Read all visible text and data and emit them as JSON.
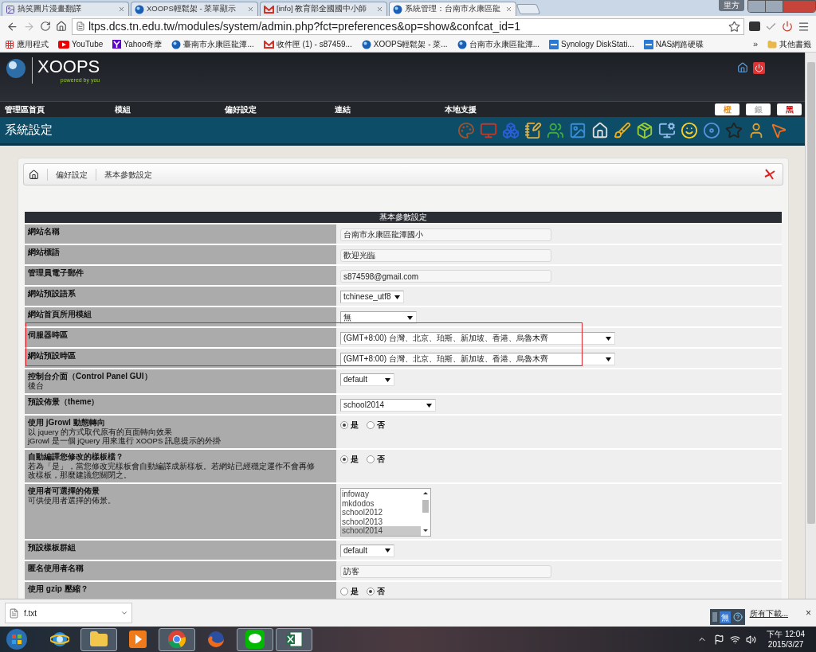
{
  "browser_tabs": [
    {
      "title": "搞笑圖片漫畫翻譯",
      "kind": "image",
      "selected": false
    },
    {
      "title": "XOOPS輕鬆架 - 菜單顯示",
      "kind": "globe",
      "selected": false
    },
    {
      "title": "[info] 教育部全國國中小師",
      "kind": "gmail",
      "selected": false
    },
    {
      "title": "系統管理：台南市永康區龍",
      "kind": "globe",
      "selected": true
    }
  ],
  "profile": "里方",
  "address": {
    "url": "ltps.dcs.tn.edu.tw/modules/system/admin.php?fct=preferences&op=show&confcat_id=1"
  },
  "bookmarks": [
    {
      "label": "應用程式",
      "kind": "apps"
    },
    {
      "label": "YouTube",
      "kind": "youtube"
    },
    {
      "label": "Yahoo奇摩",
      "kind": "yahoo"
    },
    {
      "label": "臺南市永康區龍潭...",
      "kind": "globe"
    },
    {
      "label": "收件匣 (1) - s87459...",
      "kind": "gmail"
    },
    {
      "label": "XOOPS輕鬆架 - 菜...",
      "kind": "globe"
    },
    {
      "label": "台南市永康區龍潭...",
      "kind": "globe"
    },
    {
      "label": "Synology DiskStati...",
      "kind": "dsm"
    },
    {
      "label": "NAS網路硬碟",
      "kind": "dsm"
    }
  ],
  "bookmarks_more": "»",
  "other_bookmarks": "其他書籤",
  "header": {
    "logo": "XOOPS",
    "tagline": "powered by you"
  },
  "nav": {
    "items": [
      "管理區首頁",
      "模組",
      "偏好設定",
      "連結",
      "本地支援"
    ],
    "themes": [
      {
        "label": "橙",
        "color": "#f08c00"
      },
      {
        "label": "銀",
        "color": "#b0b0b0"
      },
      {
        "label": "黑",
        "color": "#d40000"
      }
    ]
  },
  "page_title": "系統設定",
  "breadcrumb": [
    "偏好設定",
    "基本參數設定"
  ],
  "settings": {
    "title": "基本參數設定",
    "rows": [
      {
        "label": "網站名稱",
        "kind": "text",
        "value": "台南市永康區龍潭國小",
        "highlighted": false
      },
      {
        "label": "網站標語",
        "kind": "text",
        "value": "歡迎光臨",
        "highlighted": false
      },
      {
        "label": "管理員電子郵件",
        "kind": "text",
        "value": "s874598@gmail.com",
        "highlighted": false
      },
      {
        "label": "網站預設語系",
        "kind": "select",
        "value": "tchinese_utf8",
        "highlighted": false
      },
      {
        "label": "網站首頁所用模組",
        "kind": "select",
        "value": "無",
        "highlighted": false
      },
      {
        "label": "伺服器時區",
        "kind": "select",
        "value": "(GMT+8:00) 台灣、北京、珀斯、新加坡、香港、烏魯木齊",
        "highlighted": true
      },
      {
        "label": "網站預設時區",
        "kind": "select",
        "value": "(GMT+8:00) 台灣、北京、珀斯、新加坡、香港、烏魯木齊",
        "highlighted": true
      },
      {
        "label": "控制台介面（Control Panel GUI）",
        "description": [
          "後台"
        ],
        "kind": "select",
        "value": "default",
        "highlighted": false
      },
      {
        "label": "預設佈景（theme）",
        "kind": "select",
        "value": "school2014",
        "highlighted": false
      },
      {
        "label": "使用 jGrowl 動態轉向",
        "description": [
          "以 jquery 的方式取代原有的頁面轉向效果",
          "jGrowl 是一個 jQuery 用來進行 XOOPS 訊息提示的外掛"
        ],
        "kind": "radio",
        "options": [
          {
            "label": "是",
            "selected": true
          },
          {
            "label": "否",
            "selected": false
          }
        ],
        "highlighted": false
      },
      {
        "label": "自動編譯您修改的樣板檔？",
        "description": [
          "若為「是」，當您修改完樣板會自動編譯成新樣板。若網站已經穩定運作不會再修改樣板，那麼建議您關閉之。"
        ],
        "kind": "radio",
        "options": [
          {
            "label": "是",
            "selected": true
          },
          {
            "label": "否",
            "selected": false
          }
        ],
        "highlighted": false
      },
      {
        "label": "使用者可選擇的佈景",
        "description": [
          "可供使用者選擇的佈景。"
        ],
        "kind": "listbox",
        "options": [
          {
            "label": "infoway",
            "selected": false
          },
          {
            "label": "mkdodos",
            "selected": false
          },
          {
            "label": "school2012",
            "selected": false
          },
          {
            "label": "school2013",
            "selected": false
          },
          {
            "label": "school2014",
            "selected": true
          }
        ],
        "highlighted": false
      },
      {
        "label": "預設樣板群組",
        "kind": "select",
        "value": "default",
        "highlighted": false
      },
      {
        "label": "匿名使用者名稱",
        "kind": "text",
        "value": "訪客",
        "highlighted": false
      },
      {
        "label": "使用 gzip 壓縮？",
        "kind": "radio",
        "options": [
          {
            "label": "是",
            "selected": false
          },
          {
            "label": "否",
            "selected": true
          }
        ],
        "highlighted": false
      }
    ]
  },
  "downloads": {
    "file": "f.txt",
    "show_all": "所有下載...",
    "close": "×",
    "ime": "無"
  },
  "taskbar": {
    "apps": [
      {
        "kind": "ie",
        "running": false
      },
      {
        "kind": "folder",
        "running": true
      },
      {
        "kind": "media",
        "running": false
      },
      {
        "kind": "chrome",
        "running": true
      },
      {
        "kind": "firefox",
        "running": false
      },
      {
        "kind": "line",
        "running": true
      },
      {
        "kind": "excel",
        "running": true
      }
    ],
    "time": "下午 12:04",
    "date": "2015/3/27"
  }
}
